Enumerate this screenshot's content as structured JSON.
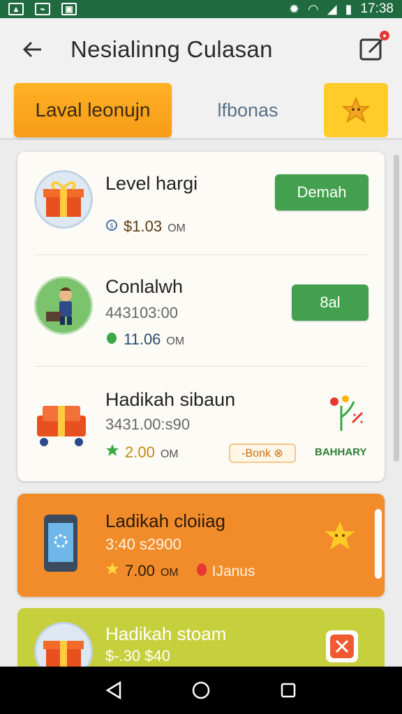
{
  "status_bar": {
    "time": "17:38"
  },
  "header": {
    "title": "Nesialinng Culasan"
  },
  "tabs": {
    "active_label": "Laval leonujn",
    "inactive_label": "lfbonas"
  },
  "list": [
    {
      "title": "Level hargi",
      "amount": "$1.03",
      "unit": "OM",
      "button": "Demah"
    },
    {
      "title": "Conlalwh",
      "subtitle": "443103:00",
      "amount": "11.06",
      "unit": "OM",
      "button": "8al"
    },
    {
      "title": "Hadikah sibaun",
      "subtitle": "3431.00:s90",
      "amount": "2.00",
      "unit": "OM",
      "pill": "-Bonk ⊗",
      "tag": "BAHHARY"
    }
  ],
  "promo_orange": {
    "title": "Ladikah cloiiag",
    "subtitle": "3:40 s2900",
    "amount": "7.00",
    "unit": "OM",
    "bonus": "IJanus"
  },
  "promo_lime": {
    "title": "Hadikah stoam",
    "subtitle": "$-.30 $40"
  },
  "colors": {
    "status_bar": "#1f6b3f",
    "accent_orange": "#f7a01c",
    "green_button": "#43a04e",
    "orange_card": "#f28c2b",
    "lime_card": "#c6cf3c"
  },
  "icons": [
    "back-arrow-icon",
    "edit-icon",
    "star-icon",
    "gift-icon",
    "person-icon",
    "flower-icon",
    "phone-icon",
    "close-icon"
  ]
}
